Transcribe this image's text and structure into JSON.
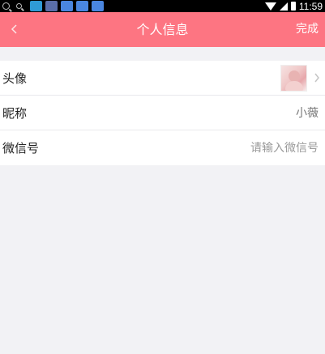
{
  "status_bar": {
    "time": "11:59",
    "app_icons": [
      "app-icon",
      "news-icon",
      "paw-icon",
      "paw-icon",
      "paw-icon"
    ]
  },
  "nav": {
    "title": "个人信息",
    "done_label": "完成",
    "back_icon": "chevron-left-icon"
  },
  "profile": {
    "rows": [
      {
        "label": "头像",
        "type": "avatar",
        "icon": "chevron-right-icon"
      },
      {
        "label": "昵称",
        "value": "小薇"
      },
      {
        "label": "微信号",
        "placeholder": "请输入微信号",
        "value": ""
      }
    ]
  },
  "colors": {
    "accent": "#fd7582",
    "background": "#f2f2f5",
    "row_background": "#ffffff",
    "divider": "#e9e9ec"
  }
}
